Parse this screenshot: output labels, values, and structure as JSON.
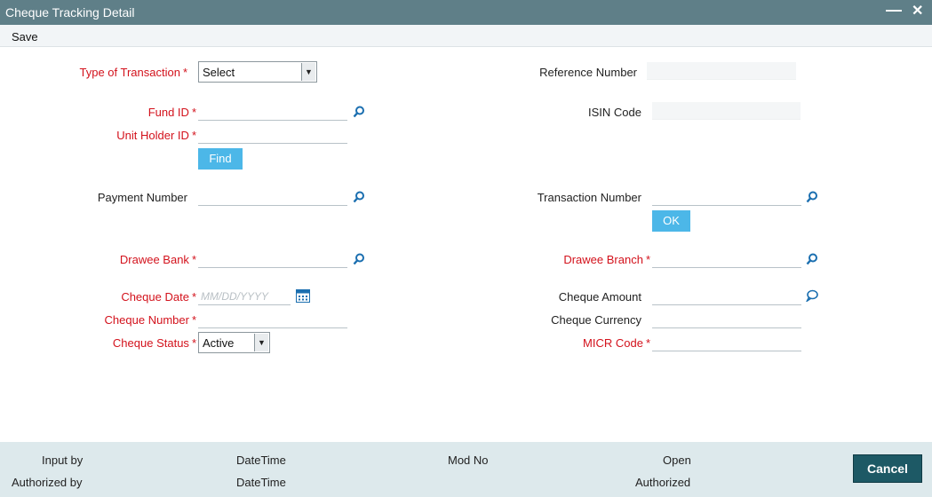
{
  "window": {
    "title": "Cheque Tracking Detail"
  },
  "menu": {
    "save": "Save"
  },
  "form": {
    "type_of_transaction": {
      "label": "Type of Transaction",
      "value": "Select"
    },
    "reference_number": {
      "label": "Reference Number",
      "value": ""
    },
    "fund_id": {
      "label": "Fund ID",
      "value": ""
    },
    "isin_code": {
      "label": "ISIN Code",
      "value": ""
    },
    "unit_holder_id": {
      "label": "Unit Holder ID",
      "value": ""
    },
    "find_button": "Find",
    "payment_number": {
      "label": "Payment Number",
      "value": ""
    },
    "transaction_number": {
      "label": "Transaction Number",
      "value": ""
    },
    "ok_button": "OK",
    "drawee_bank": {
      "label": "Drawee Bank",
      "value": ""
    },
    "drawee_branch": {
      "label": "Drawee Branch",
      "value": ""
    },
    "cheque_date": {
      "label": "Cheque Date",
      "placeholder": "MM/DD/YYYY",
      "value": ""
    },
    "cheque_amount": {
      "label": "Cheque Amount",
      "value": ""
    },
    "cheque_number": {
      "label": "Cheque Number",
      "value": ""
    },
    "cheque_currency": {
      "label": "Cheque Currency",
      "value": ""
    },
    "cheque_status": {
      "label": "Cheque Status",
      "value": "Active"
    },
    "micr_code": {
      "label": "MICR Code",
      "value": ""
    },
    "required_marker": "*"
  },
  "footer": {
    "input_by": "Input by",
    "authorized_by": "Authorized by",
    "datetime_1": "DateTime",
    "datetime_2": "DateTime",
    "mod_no": "Mod No",
    "open": "Open",
    "authorized": "Authorized",
    "cancel": "Cancel"
  },
  "colors": {
    "titlebar": "#5f7f88",
    "required": "#d3121c",
    "button_blue": "#4cb7e8",
    "cancel_button": "#1d5965",
    "footer": "#dde9ec"
  },
  "icons": {
    "lookup": "magnifier-icon",
    "calendar": "calendar-icon",
    "amount": "speech-bubble-icon"
  }
}
